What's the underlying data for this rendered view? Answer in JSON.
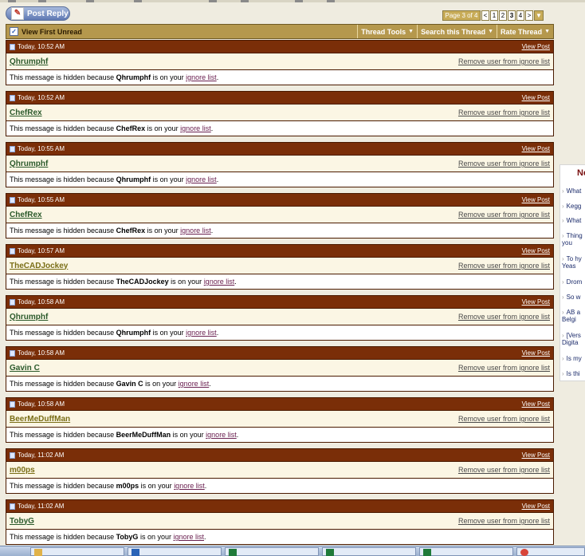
{
  "post_reply_label": "Post Reply",
  "pagination": {
    "label": "Page 3 of 4",
    "prev": "<",
    "pages": [
      "1",
      "2",
      "3",
      "4"
    ],
    "current_page": "3",
    "next": ">",
    "menu_arrow": "▼"
  },
  "toolbar": {
    "view_first_unread": "View First Unread",
    "thread_tools": "Thread Tools",
    "search_thread": "Search this Thread",
    "rate_thread": "Rate Thread"
  },
  "posts": [
    {
      "time": "Today, 10:52 AM",
      "user": "Qhrumphf",
      "view": "View Post",
      "remove": "Remove user from ignore list",
      "msg_prefix": "This message is hidden because",
      "msg_user": "Qhrumphf",
      "msg_middle": "is on your",
      "ignore_link": "ignore list",
      "msg_end": "."
    },
    {
      "time": "Today, 10:52 AM",
      "user": "ChefRex",
      "view": "View Post",
      "remove": "Remove user from ignore list",
      "msg_prefix": "This message is hidden because",
      "msg_user": "ChefRex",
      "msg_middle": "is on your",
      "ignore_link": "ignore list",
      "msg_end": "."
    },
    {
      "time": "Today, 10:55 AM",
      "user": "Qhrumphf",
      "view": "View Post",
      "remove": "Remove user from ignore list",
      "msg_prefix": "This message is hidden because",
      "msg_user": "Qhrumphf",
      "msg_middle": "is on your",
      "ignore_link": "ignore list",
      "msg_end": "."
    },
    {
      "time": "Today, 10:55 AM",
      "user": "ChefRex",
      "view": "View Post",
      "remove": "Remove user from ignore list",
      "msg_prefix": "This message is hidden because",
      "msg_user": "ChefRex",
      "msg_middle": "is on your",
      "ignore_link": "ignore list",
      "msg_end": "."
    },
    {
      "time": "Today, 10:57 AM",
      "user": "TheCADJockey",
      "view": "View Post",
      "remove": "Remove user from ignore list",
      "msg_prefix": "This message is hidden because",
      "msg_user": "TheCADJockey",
      "msg_middle": "is on your",
      "ignore_link": "ignore list",
      "msg_end": "."
    },
    {
      "time": "Today, 10:58 AM",
      "user": "Qhrumphf",
      "view": "View Post",
      "remove": "Remove user from ignore list",
      "msg_prefix": "This message is hidden because",
      "msg_user": "Qhrumphf",
      "msg_middle": "is on your",
      "ignore_link": "ignore list",
      "msg_end": "."
    },
    {
      "time": "Today, 10:58 AM",
      "user": "Gavin C",
      "view": "View Post",
      "remove": "Remove user from ignore list",
      "msg_prefix": "This message is hidden because",
      "msg_user": "Gavin C",
      "msg_middle": "is on your",
      "ignore_link": "ignore list",
      "msg_end": "."
    },
    {
      "time": "Today, 10:58 AM",
      "user": "BeerMeDuffMan",
      "view": "View Post",
      "remove": "Remove user from ignore list",
      "msg_prefix": "This message is hidden because",
      "msg_user": "BeerMeDuffMan",
      "msg_middle": "is on your",
      "ignore_link": "ignore list",
      "msg_end": "."
    },
    {
      "time": "Today, 11:02 AM",
      "user": "m00ps",
      "view": "View Post",
      "remove": "Remove user from ignore list",
      "msg_prefix": "This message is hidden because",
      "msg_user": "m00ps",
      "msg_middle": "is on your",
      "ignore_link": "ignore list",
      "msg_end": "."
    },
    {
      "time": "Today, 11:02 AM",
      "user": "TobyG",
      "view": "View Post",
      "remove": "Remove user from ignore list",
      "msg_prefix": "This message is hidden because",
      "msg_user": "TobyG",
      "msg_middle": "is on your",
      "ignore_link": "ignore list",
      "msg_end": "."
    }
  ],
  "sidebar": {
    "heading": "Ne",
    "items": [
      "What",
      "Kegg",
      "What",
      "Thing you",
      "To hy Yeas",
      "Drom",
      "So w",
      "AB a Belgi",
      "[Vers Digita",
      "Is my",
      "Is thi"
    ]
  },
  "colors": {
    "post_header": "#7a2e08",
    "toolbar": "#b5984d",
    "username": "#2b5a2b"
  }
}
